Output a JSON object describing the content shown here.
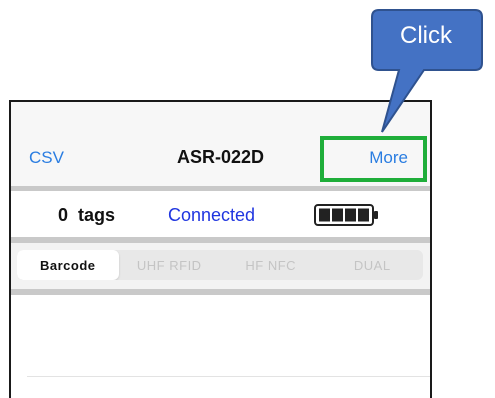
{
  "navbar": {
    "left_label": "CSV",
    "title": "ASR-022D",
    "right_label": "More"
  },
  "status": {
    "tag_count": "0",
    "tags_label": "tags",
    "connection": "Connected",
    "battery_icon": "battery-full-icon",
    "battery_level": 1.0
  },
  "segments": {
    "items": [
      {
        "label": "Barcode",
        "active": true
      },
      {
        "label": "UHF RFID",
        "active": false
      },
      {
        "label": "HF NFC",
        "active": false
      },
      {
        "label": "DUAL",
        "active": false
      }
    ]
  },
  "callout": {
    "label": "Click",
    "color": "#4472c4",
    "border": "#2f528f"
  },
  "colors": {
    "link_blue": "#2a7de1",
    "connected_blue": "#1f35e0",
    "highlight_green": "#1fae3a"
  }
}
